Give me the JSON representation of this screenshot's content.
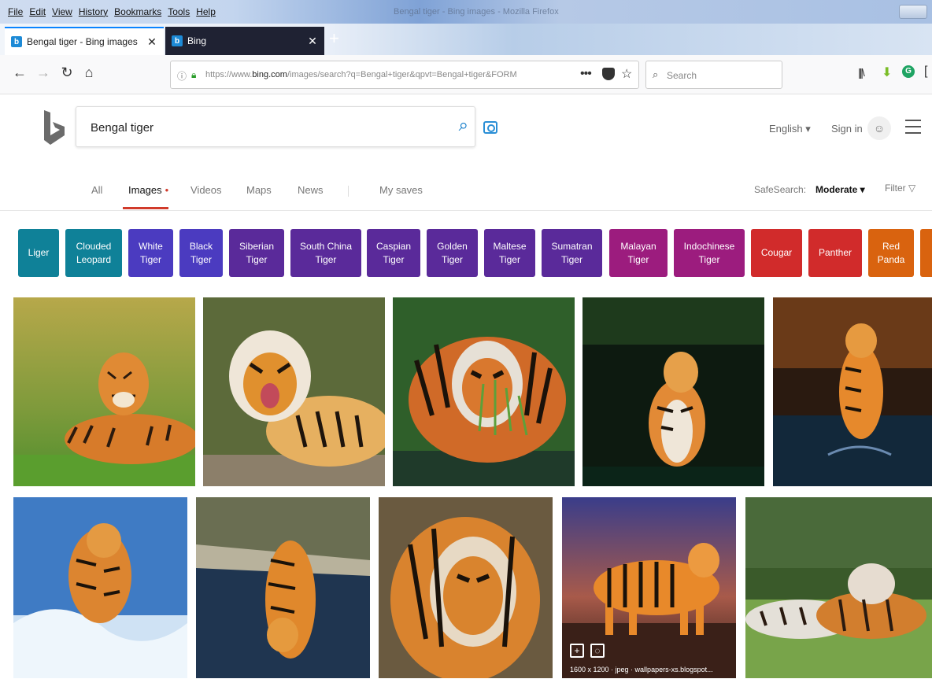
{
  "browser": {
    "menu": [
      "File",
      "Edit",
      "View",
      "History",
      "Bookmarks",
      "Tools",
      "Help"
    ],
    "window_title": "Bengal tiger - Bing images - Mozilla Firefox",
    "tabs": [
      {
        "title": "Bengal tiger - Bing images",
        "close": "✕"
      },
      {
        "title": "Bing",
        "close": "✕"
      }
    ],
    "new_tab": "+",
    "url_prefix": "https://www.",
    "url_host": "bing.com",
    "url_path": "/images/search?q=Bengal+tiger&qpvt=Bengal+tiger&FORM",
    "url_more": "•••",
    "search_placeholder": "Search",
    "colors": {
      "tab_active_border": "#0a84ff",
      "dark_tab": "#1f2233"
    }
  },
  "bing": {
    "query": "Bengal tiger",
    "language": "English ▾",
    "sign_in": "Sign in",
    "nav": [
      {
        "label": "All"
      },
      {
        "label": "Images"
      },
      {
        "label": "Videos"
      },
      {
        "label": "Maps"
      },
      {
        "label": "News"
      },
      {
        "label": "My saves"
      }
    ],
    "active_dot": "•",
    "safesearch_label": "SafeSearch:",
    "safesearch_value": "Moderate ▾",
    "filter_label": "Filter",
    "filter_icon": "▽",
    "accent": "#d13b2b"
  },
  "related": [
    {
      "label": "Liger",
      "color": "#0f8198"
    },
    {
      "label": "Clouded\nLeopard",
      "color": "#0f8198"
    },
    {
      "label": "White\nTiger",
      "color": "#4b3bc0"
    },
    {
      "label": "Black\nTiger",
      "color": "#4b3bc0"
    },
    {
      "label": "Siberian\nTiger",
      "color": "#5a2a9a"
    },
    {
      "label": "South China\nTiger",
      "color": "#5a2a9a"
    },
    {
      "label": "Caspian\nTiger",
      "color": "#5a2a9a"
    },
    {
      "label": "Golden\nTiger",
      "color": "#5a2a9a"
    },
    {
      "label": "Maltese\nTiger",
      "color": "#5a2a9a"
    },
    {
      "label": "Sumatran\nTiger",
      "color": "#5a2a9a"
    },
    {
      "label": "Malayan\nTiger",
      "color": "#9c1c7e"
    },
    {
      "label": "Indochinese\nTiger",
      "color": "#9c1c7e"
    },
    {
      "label": "Cougar",
      "color": "#d12b2b"
    },
    {
      "label": "Panther",
      "color": "#d12b2b"
    },
    {
      "label": "Red\nPanda",
      "color": "#d9630f"
    }
  ],
  "overlay": {
    "info": "1600 x 1200 · jpeg · wallpapers-xs.blogspot..."
  }
}
